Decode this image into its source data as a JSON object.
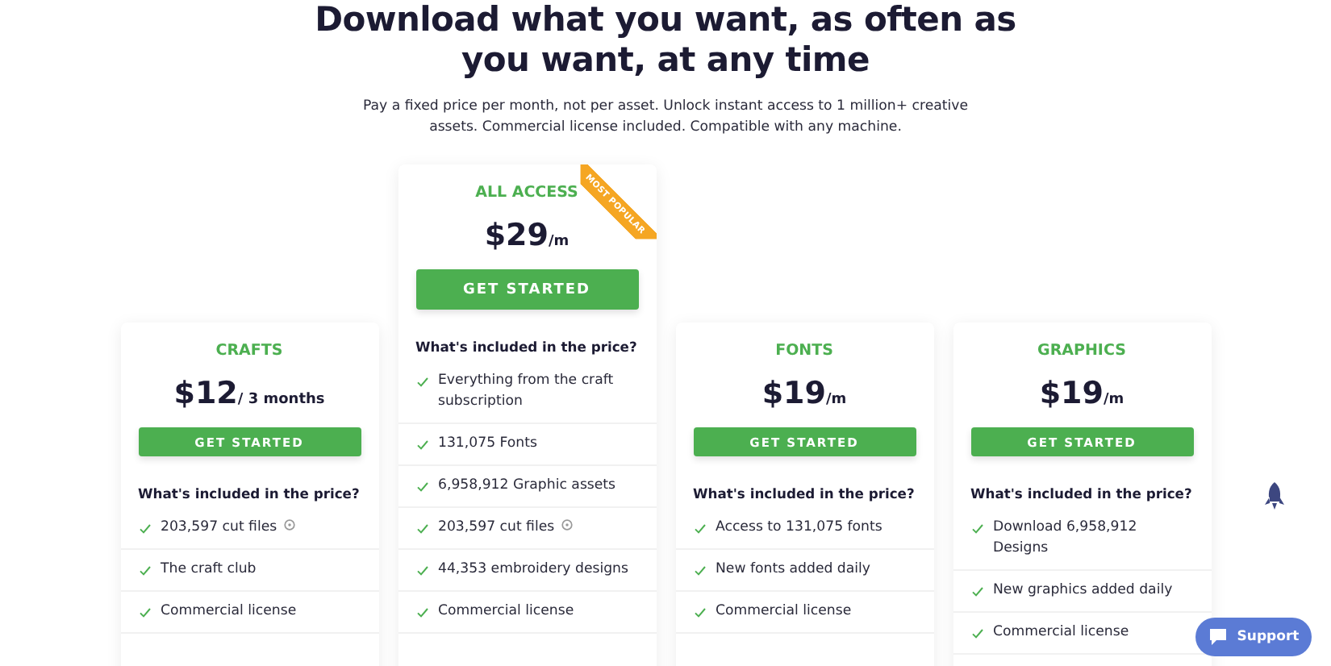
{
  "heading": "Download what you want, as often as you want, at any time",
  "subtitle": "Pay a fixed price per month, not per asset. Unlock instant access to 1 million+ creative assets. Commercial license included. Compatible with any machine.",
  "plans": [
    {
      "name": "CRAFTS",
      "price": "$12",
      "period": "/ 3 months",
      "featured": false,
      "button": "GET STARTED",
      "included_heading": "What's included in the price?",
      "features": [
        {
          "text": "203,597 cut files",
          "info": true
        },
        {
          "text": "The craft club",
          "info": false
        },
        {
          "text": "Commercial license",
          "info": false
        }
      ]
    },
    {
      "name": "ALL ACCESS",
      "price": "$29",
      "period": "/m",
      "featured": true,
      "ribbon": "MOST POPULAR",
      "button": "GET STARTED",
      "included_heading": "What's included in the price?",
      "features": [
        {
          "text": "Everything from the craft subscription",
          "info": false
        },
        {
          "text": "131,075 Fonts",
          "info": false
        },
        {
          "text": "6,958,912 Graphic assets",
          "info": false
        },
        {
          "text": "203,597 cut files",
          "info": true
        },
        {
          "text": "44,353 embroidery designs",
          "info": false
        },
        {
          "text": "Commercial license",
          "info": false
        }
      ]
    },
    {
      "name": "FONTS",
      "price": "$19",
      "period": "/m",
      "featured": false,
      "button": "GET STARTED",
      "included_heading": "What's included in the price?",
      "features": [
        {
          "text": "Access to 131,075 fonts",
          "info": false
        },
        {
          "text": "New fonts added daily",
          "info": false
        },
        {
          "text": "Commercial license",
          "info": false
        }
      ]
    },
    {
      "name": "GRAPHICS",
      "price": "$19",
      "period": "/m",
      "featured": false,
      "button": "GET STARTED",
      "included_heading": "What's included in the price?",
      "features": [
        {
          "text": "Download 6,958,912 Designs",
          "info": false
        },
        {
          "text": "New graphics added daily",
          "info": false
        },
        {
          "text": "Commercial license",
          "info": false
        }
      ]
    }
  ],
  "support_button": "Support"
}
